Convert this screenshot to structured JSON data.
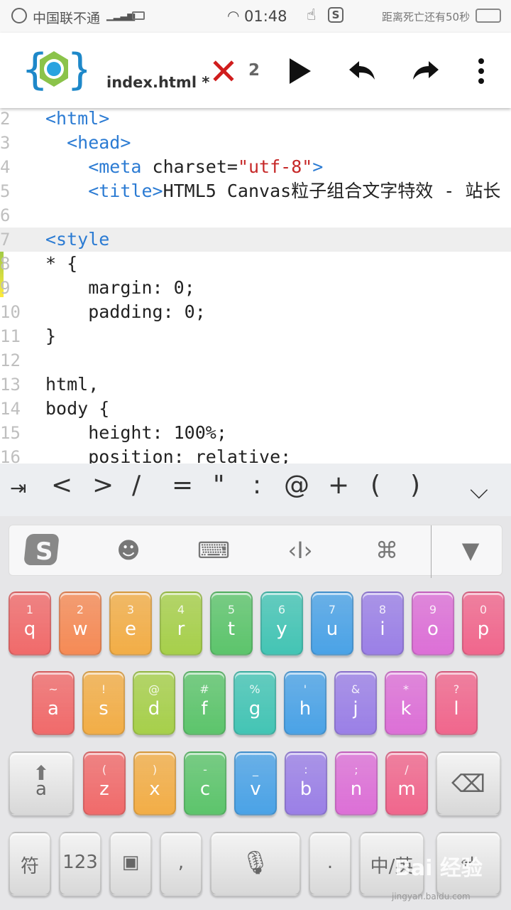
{
  "status": {
    "carrier": "中国联不通",
    "time": "01:48",
    "countdown": "距离死亡还有50秒"
  },
  "toolbar": {
    "filename": "index.html *",
    "error_count": "2"
  },
  "editor": {
    "lines": [
      {
        "n": "2",
        "parts": [
          {
            "t": "<html>",
            "c": "tag"
          }
        ]
      },
      {
        "n": "3",
        "parts": [
          {
            "t": "  <head>",
            "c": "tag"
          }
        ]
      },
      {
        "n": "4",
        "parts": [
          {
            "t": "    <meta ",
            "c": "tag"
          },
          {
            "t": "charset=",
            "c": ""
          },
          {
            "t": "\"utf-8\"",
            "c": "str"
          },
          {
            "t": ">",
            "c": "tag"
          }
        ]
      },
      {
        "n": "5",
        "parts": [
          {
            "t": "    <title>",
            "c": "tag"
          },
          {
            "t": "HTML5 Canvas粒子组合文字特效 - 站长",
            "c": ""
          }
        ]
      },
      {
        "n": "6",
        "parts": []
      },
      {
        "n": "7",
        "parts": [
          {
            "t": "<style",
            "c": "tag"
          }
        ],
        "hl": true
      },
      {
        "n": "8",
        "parts": [
          {
            "t": "* {",
            "c": ""
          }
        ]
      },
      {
        "n": "9",
        "parts": [
          {
            "t": "    margin: 0;",
            "c": ""
          }
        ]
      },
      {
        "n": "10",
        "parts": [
          {
            "t": "    padding: 0;",
            "c": ""
          }
        ]
      },
      {
        "n": "11",
        "parts": [
          {
            "t": "}",
            "c": ""
          }
        ]
      },
      {
        "n": "12",
        "parts": []
      },
      {
        "n": "13",
        "parts": [
          {
            "t": "html,",
            "c": ""
          }
        ]
      },
      {
        "n": "14",
        "parts": [
          {
            "t": "body {",
            "c": ""
          }
        ]
      },
      {
        "n": "15",
        "parts": [
          {
            "t": "    height: 100%;",
            "c": ""
          }
        ]
      },
      {
        "n": "16",
        "parts": [
          {
            "t": "    position: relative;",
            "c": ""
          }
        ]
      }
    ]
  },
  "symbols": [
    "<",
    ">",
    "/",
    "=",
    "\"",
    ":",
    "@",
    "+",
    "(",
    ")"
  ],
  "keyboard": {
    "row1": [
      {
        "num": "1",
        "let": "q",
        "color": "#f06a6a"
      },
      {
        "num": "2",
        "let": "w",
        "color": "#f58a55"
      },
      {
        "num": "3",
        "let": "e",
        "color": "#f2ad46"
      },
      {
        "num": "4",
        "let": "r",
        "color": "#a6cf4a"
      },
      {
        "num": "5",
        "let": "t",
        "color": "#5cc46b"
      },
      {
        "num": "6",
        "let": "y",
        "color": "#43c4b4"
      },
      {
        "num": "7",
        "let": "u",
        "color": "#4aa2e6"
      },
      {
        "num": "8",
        "let": "i",
        "color": "#9a7fe6"
      },
      {
        "num": "9",
        "let": "o",
        "color": "#dc6fd6"
      },
      {
        "num": "0",
        "let": "p",
        "color": "#f0668c"
      }
    ],
    "row2": [
      {
        "num": "~",
        "let": "a",
        "color": "#f06a6a"
      },
      {
        "num": "!",
        "let": "s",
        "color": "#f2ad46"
      },
      {
        "num": "@",
        "let": "d",
        "color": "#a6cf4a"
      },
      {
        "num": "#",
        "let": "f",
        "color": "#5cc46b"
      },
      {
        "num": "%",
        "let": "g",
        "color": "#43c4b4"
      },
      {
        "num": "'",
        "let": "h",
        "color": "#4aa2e6"
      },
      {
        "num": "&",
        "let": "j",
        "color": "#9a7fe6"
      },
      {
        "num": "*",
        "let": "k",
        "color": "#dc6fd6"
      },
      {
        "num": "?",
        "let": "l",
        "color": "#f0668c"
      }
    ],
    "row3": [
      {
        "num": "(",
        "let": "z",
        "color": "#f06a6a"
      },
      {
        "num": ")",
        "let": "x",
        "color": "#f2ad46"
      },
      {
        "num": "-",
        "let": "c",
        "color": "#5cc46b"
      },
      {
        "num": "_",
        "let": "v",
        "color": "#4aa2e6"
      },
      {
        "num": ":",
        "let": "b",
        "color": "#9a7fe6"
      },
      {
        "num": ";",
        "let": "n",
        "color": "#dc6fd6"
      },
      {
        "num": "/",
        "let": "m",
        "color": "#f0668c"
      }
    ],
    "shift_letter": "a",
    "bottom": {
      "symbols": "符",
      "numbers": "123",
      "comma": ",",
      "period": ".",
      "lang": "中/英"
    }
  },
  "watermark": {
    "text": "Bai 经验",
    "url": "jingyan.baidu.com"
  }
}
